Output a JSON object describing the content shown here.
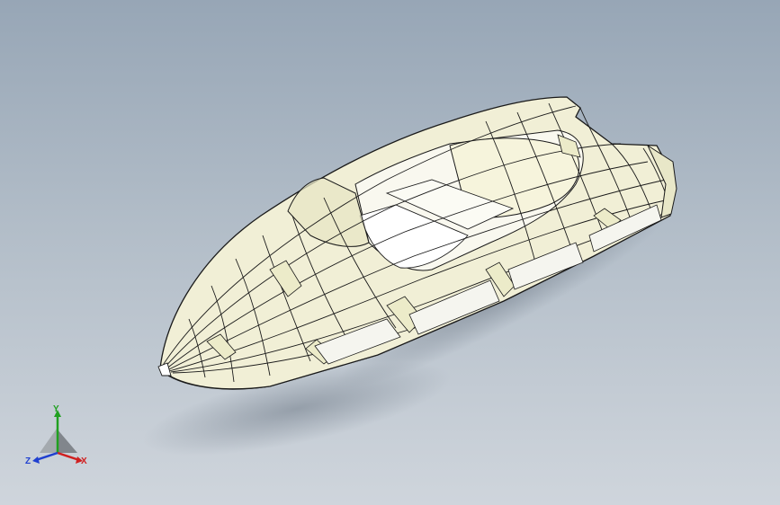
{
  "viewport": {
    "background_top": "#97a6b6",
    "background_bottom": "#cfd5dc"
  },
  "model": {
    "description_icon": "boat-hull-wireframe-model",
    "hull_color": "#f3f1dc",
    "frame_color": "#ecebc9",
    "deck_color": "#f7f7ee",
    "line_color": "#1a1a1a"
  },
  "triad": {
    "x_label": "X",
    "y_label": "Y",
    "z_label": "Z",
    "x_color": "#d02020",
    "y_color": "#20a020",
    "z_color": "#2040d0"
  }
}
